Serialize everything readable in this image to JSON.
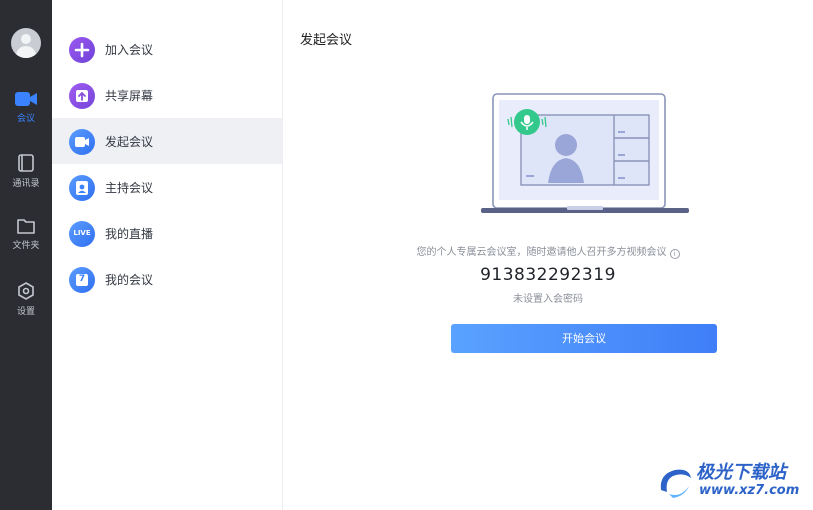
{
  "sidebar": {
    "items": [
      {
        "label": "会议",
        "icon": "video-camera-icon",
        "active": true
      },
      {
        "label": "通讯录",
        "icon": "contacts-book-icon",
        "active": false
      },
      {
        "label": "文件夹",
        "icon": "folder-icon",
        "active": false
      },
      {
        "label": "设置",
        "icon": "settings-hexagon-icon",
        "active": false
      }
    ]
  },
  "menu": {
    "items": [
      {
        "label": "加入会议",
        "icon": "plus-icon",
        "color": "#7b4ee0"
      },
      {
        "label": "共享屏幕",
        "icon": "share-screen-icon",
        "color": "#8a4fe0"
      },
      {
        "label": "发起会议",
        "icon": "video-icon",
        "color": "#3b82ff",
        "active": true
      },
      {
        "label": "主持会议",
        "icon": "host-icon",
        "color": "#3b82ff"
      },
      {
        "label": "我的直播",
        "icon": "live-icon",
        "color": "#3b82ff",
        "badge": "LIVE"
      },
      {
        "label": "我的会议",
        "icon": "calendar-icon",
        "color": "#3b82ff",
        "badge": "7"
      }
    ]
  },
  "main": {
    "title": "发起会议",
    "description": "您的个人专属云会议室，随时邀请他人召开多方视频会议",
    "info_glyph": "i",
    "meeting_id": "913832292319",
    "password_note": "未设置入会密码",
    "start_button": "开始会议"
  },
  "watermark": {
    "name": "极光下载站",
    "url": "www.xz7.com"
  },
  "colors": {
    "accent": "#3b82ff",
    "rail_bg": "#2b2d33",
    "active_menu_bg": "#eff0f4"
  }
}
